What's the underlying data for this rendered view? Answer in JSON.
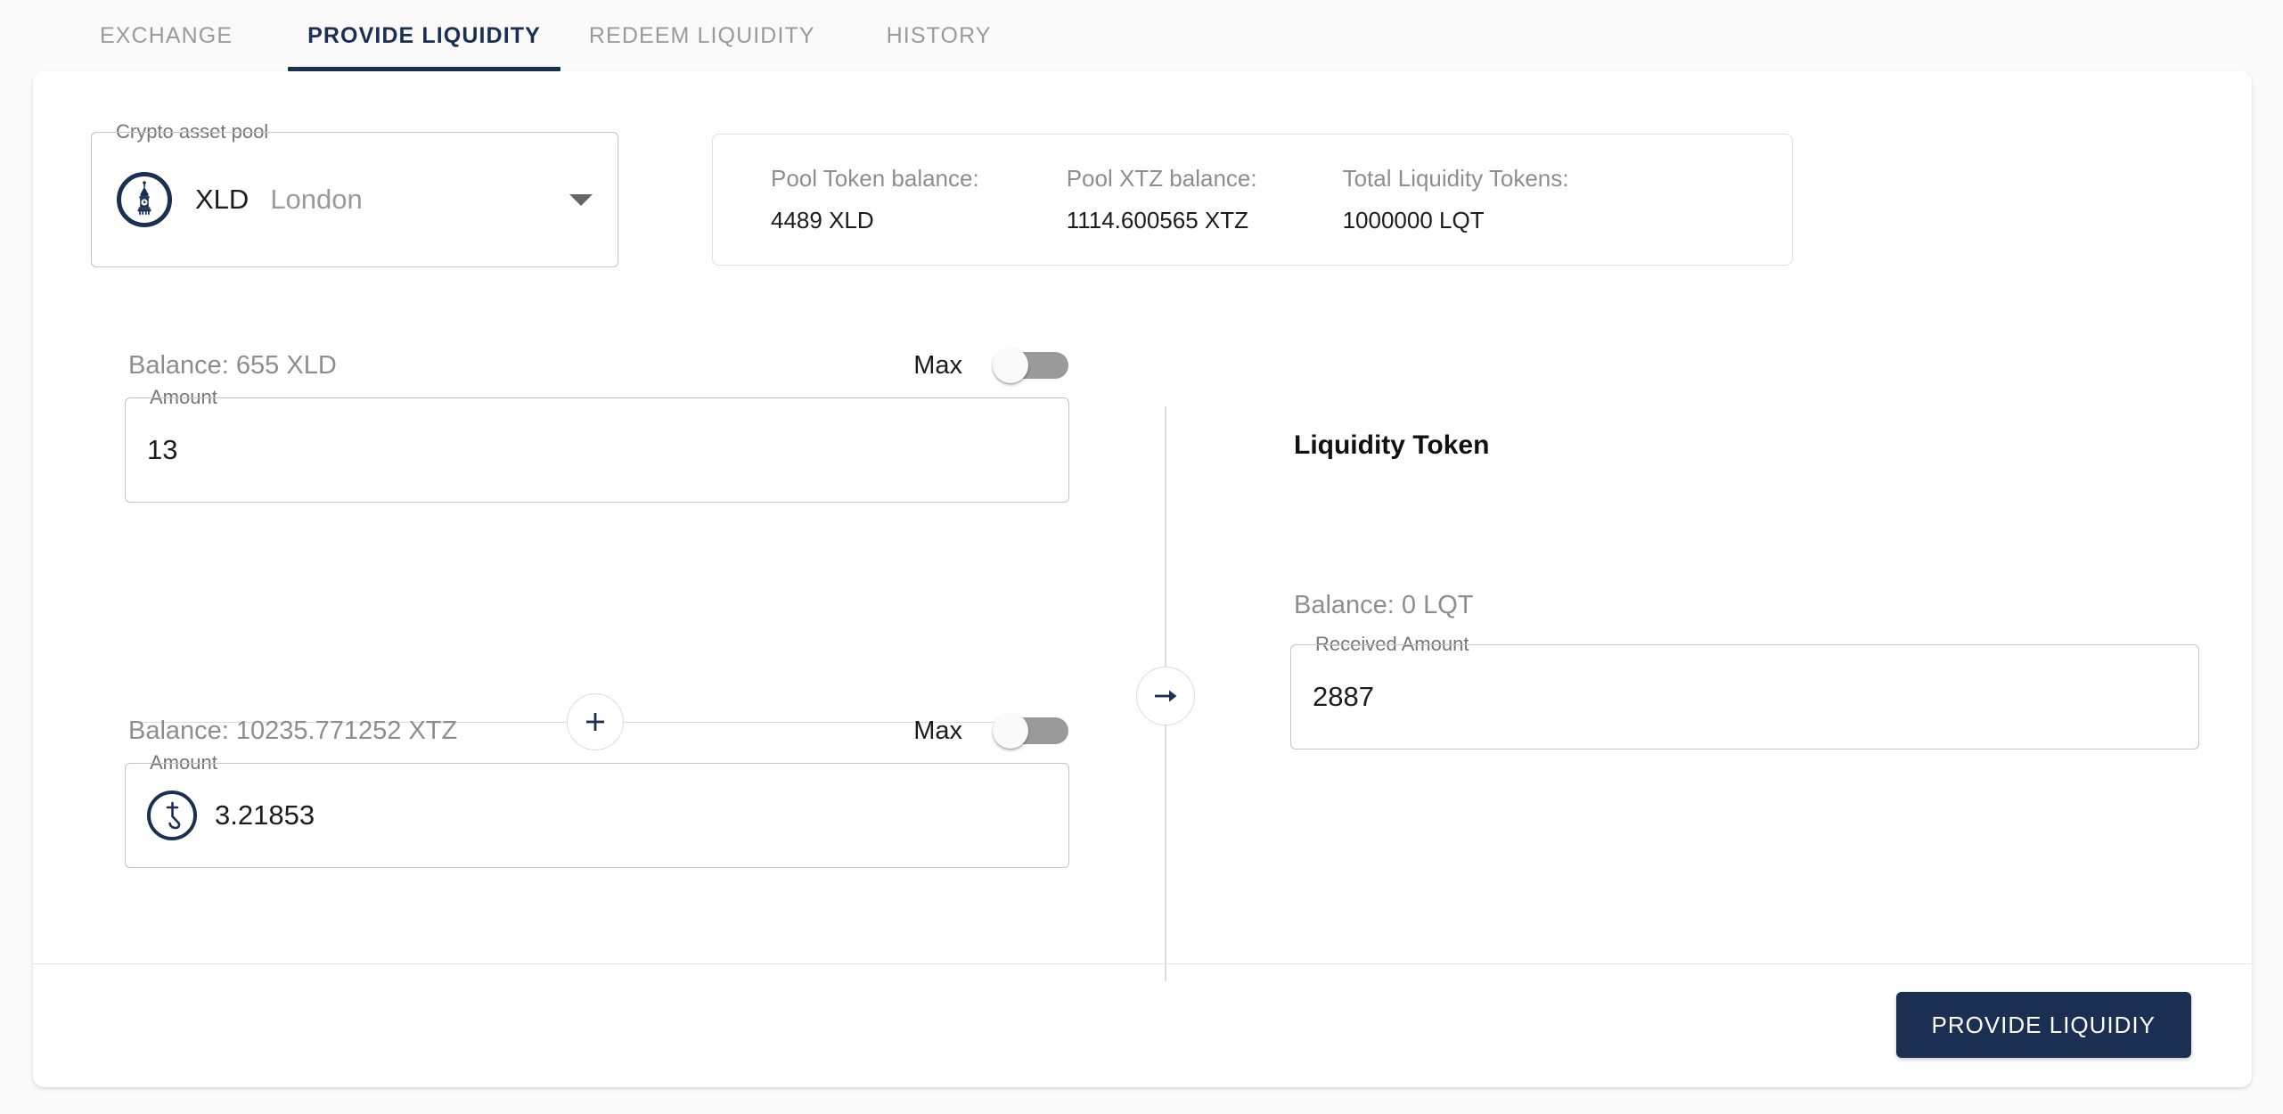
{
  "tabs": [
    {
      "label": "EXCHANGE",
      "active": false
    },
    {
      "label": "PROVIDE LIQUIDITY",
      "active": true
    },
    {
      "label": "REDEEM LIQUIDITY",
      "active": false
    },
    {
      "label": "HISTORY",
      "active": false
    }
  ],
  "pool_selector": {
    "legend": "Crypto asset pool",
    "symbol": "XLD",
    "name": "London",
    "icon": "big-ben-icon",
    "caret": "chevron-down-icon"
  },
  "pool_stats": [
    {
      "label": "Pool Token balance:",
      "value": "4489 XLD"
    },
    {
      "label": "Pool XTZ balance:",
      "value": "1114.600565 XTZ"
    },
    {
      "label": "Total Liquidity Tokens:",
      "value": "1000000 LQT"
    }
  ],
  "token_input": {
    "balance": "Balance: 655 XLD",
    "max_label": "Max",
    "max_on": false,
    "legend": "Amount",
    "value": "13",
    "placeholder": ""
  },
  "xtz_input": {
    "balance": "Balance: 10235.771252 XTZ",
    "max_label": "Max",
    "max_on": false,
    "legend": "Amount",
    "value": "3.21853",
    "icon": "tezos-icon",
    "placeholder": ""
  },
  "plus_divider": {
    "icon": "plus-icon"
  },
  "transfer": {
    "icon": "arrow-right-icon"
  },
  "liquidity": {
    "title": "Liquidity Token",
    "balance": "Balance: 0 LQT",
    "legend": "Received Amount",
    "value": "2887",
    "placeholder": ""
  },
  "footer": {
    "cta_label": "PROVIDE LIQUIDIY"
  },
  "colors": {
    "accent": "#1b2f53",
    "page_bg": "#fafafa",
    "card_bg": "#ffffff",
    "muted_text": "#8e8e8e",
    "border": "#c4c4c4",
    "switch_track": "#9a9a9a"
  }
}
